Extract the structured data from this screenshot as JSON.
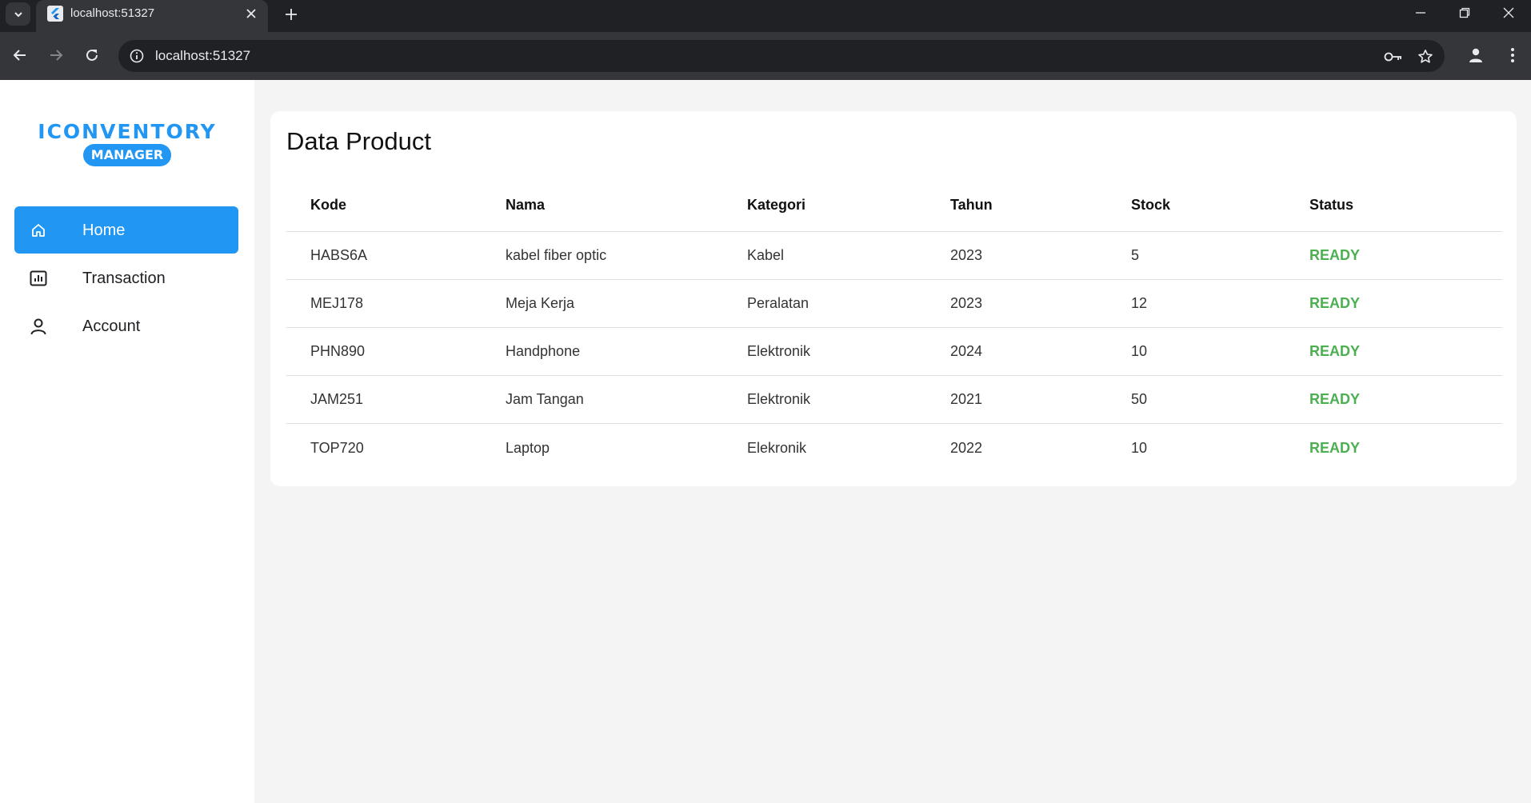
{
  "browser": {
    "tab_title": "localhost:51327",
    "url": "localhost:51327"
  },
  "sidebar": {
    "logo_top": "ICONVENTORY",
    "logo_badge": "MANAGER",
    "items": [
      {
        "label": "Home",
        "icon": "home-icon",
        "active": true
      },
      {
        "label": "Transaction",
        "icon": "bar-chart-icon",
        "active": false
      },
      {
        "label": "Account",
        "icon": "person-icon",
        "active": false
      }
    ]
  },
  "main": {
    "title": "Data Product",
    "columns": [
      "Kode",
      "Nama",
      "Kategori",
      "Tahun",
      "Stock",
      "Status"
    ],
    "rows": [
      [
        "HABS6A",
        "kabel fiber optic",
        "Kabel",
        "2023",
        "5",
        "READY"
      ],
      [
        "MEJ178",
        "Meja Kerja",
        "Peralatan",
        "2023",
        "12",
        "READY"
      ],
      [
        "PHN890",
        "Handphone",
        "Elektronik",
        "2024",
        "10",
        "READY"
      ],
      [
        "JAM251",
        "Jam Tangan",
        "Elektronik",
        "2021",
        "50",
        "READY"
      ],
      [
        "TOP720",
        "Laptop",
        "Elekronik",
        "2022",
        "10",
        "READY"
      ]
    ]
  },
  "colors": {
    "accent": "#2196f3",
    "status_ready": "#4caf50",
    "background": "#f4f4f4"
  }
}
